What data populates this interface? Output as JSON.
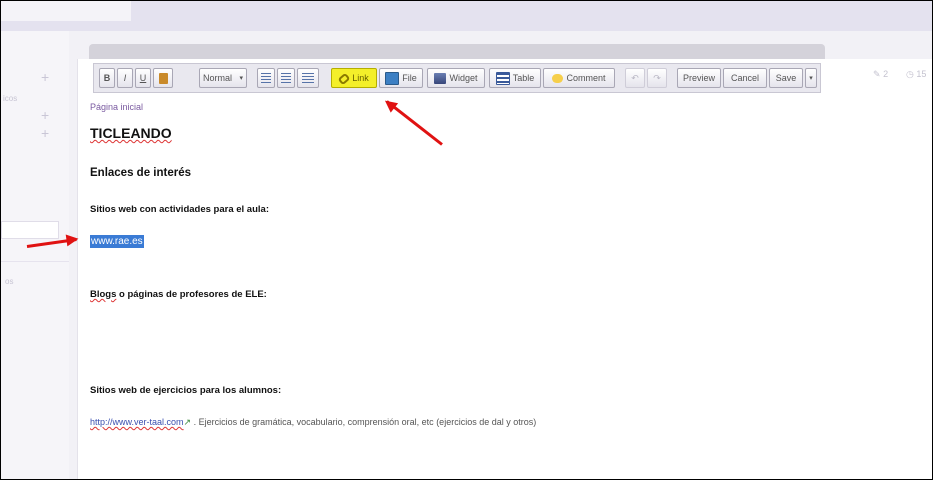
{
  "toolbar": {
    "bold": "B",
    "italic": "I",
    "underline": "U",
    "format_select": "Normal",
    "link": "Link",
    "file": "File",
    "widget": "Widget",
    "table": "Table",
    "comment": "Comment",
    "preview": "Preview",
    "cancel": "Cancel",
    "save": "Save"
  },
  "meta": {
    "count": "2",
    "timer": "15"
  },
  "left_panel": {
    "label_top": "icos",
    "label_bottom": "os"
  },
  "page": {
    "breadcrumb": "Página inicial",
    "title": "TICLEANDO",
    "section_title": "Enlaces de interés",
    "section1": "Sitios web con actividades para el aula:",
    "selected_link": "www.rae.es",
    "section2_rest": " o páginas de profesores de ELE:",
    "section2_word": "Blogs",
    "section3": "Sitios web de ejercicios para los alumnos:",
    "bottom_link": "http://www.ver-taal.com",
    "bottom_desc": " . Ejercicios de gramática, vocabulario, comprensión oral, etc (ejercicios de dal y otros)"
  },
  "colors": {
    "highlight": "#f4ef2a",
    "arrow": "#e01212",
    "selection": "#3a7bd5"
  }
}
